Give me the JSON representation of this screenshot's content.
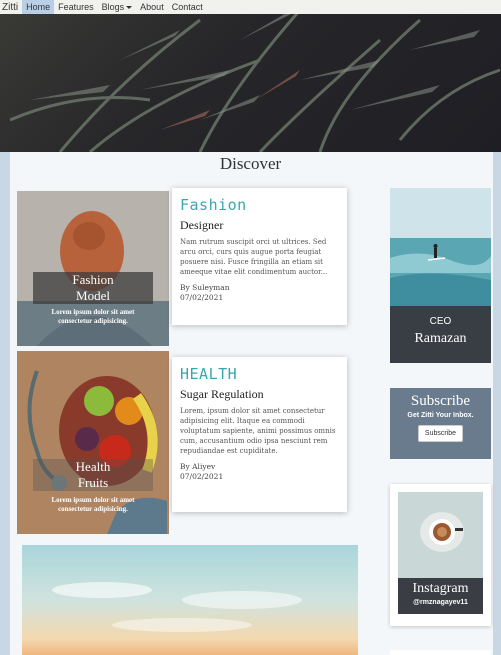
{
  "nav": {
    "brand": "Zitti",
    "items": [
      "Home",
      "Features",
      "Blogs",
      "About",
      "Contact"
    ]
  },
  "section_title": "Discover",
  "posts": [
    {
      "image_title_line1": "Fashion",
      "image_title_line2": "Model",
      "image_caption_line1": "Lorem ipsum dolor sit amet",
      "image_caption_line2": "consectetur adipisicing.",
      "category": "Fashion",
      "subtitle": "Designer",
      "body": "Nam rutrum suscipit orci ut ultrices. Sed arcu orci, curs quis augue porta feugiat posuere nisi. Fusce fringilla an etiam sit ameeque vitae elit condimentum auctor...",
      "author": "By Suleyman",
      "date": "07/02/2021"
    },
    {
      "image_title_line1": "Health",
      "image_title_line2": "Fruits",
      "image_caption_line1": "Lorem ipsum dolor sit amet",
      "image_caption_line2": "consectetur adipisicing.",
      "category": "HEALTH",
      "subtitle": "Sugar Regulation",
      "body": "Lorem, ipsum dolor sit amet consectetur adipisicing elit. Itaque ea commodi voluptatum sapiente, animi possimus omnis cum, accusantium odio ipsa nesciunt rem repudiandae est cupiditate.",
      "author": "By Aliyev",
      "date": "07/02/2021"
    }
  ],
  "ceo": {
    "title": "CEO",
    "name": "Ramazan"
  },
  "subscribe": {
    "title": "Subscribe",
    "text": "Get Zitti Your Inbox.",
    "button": "Subscribe"
  },
  "instagram": {
    "title": "Instagram",
    "handle": "@rmznagayev11"
  },
  "colors": {
    "accent": "#3aa7b0",
    "nav_active": "#b8cfe6",
    "dark_panel": "#393d44",
    "subscribe_bg": "#6b7b8e"
  }
}
